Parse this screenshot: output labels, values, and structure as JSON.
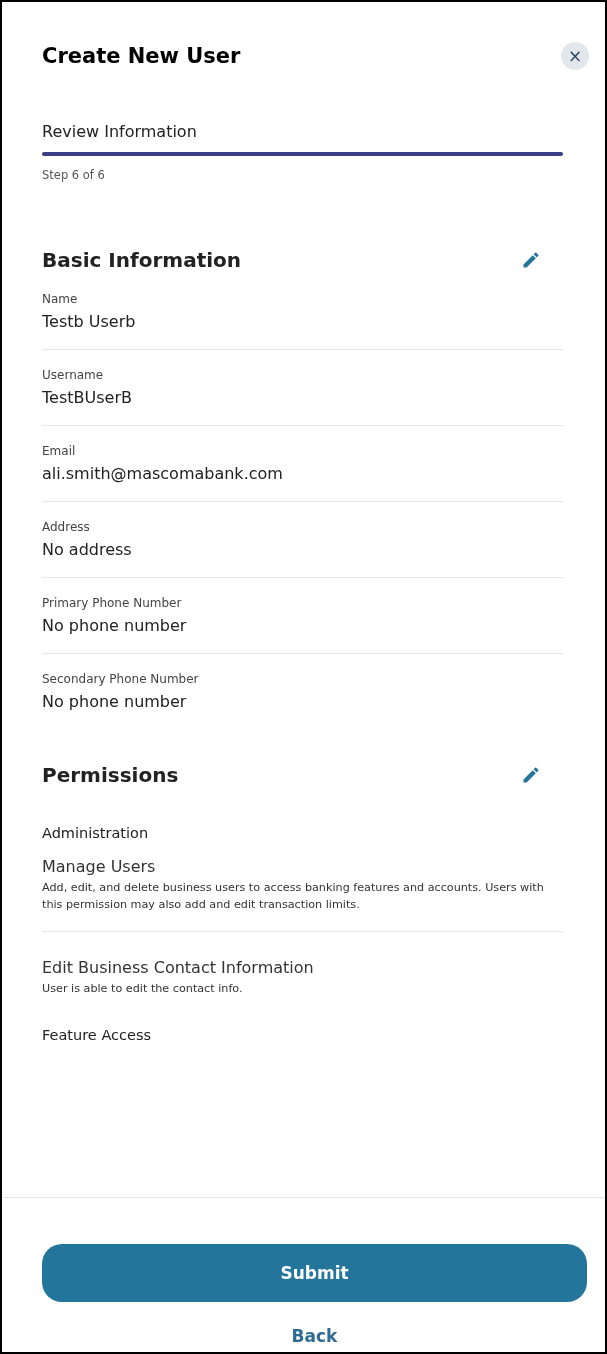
{
  "dialog": {
    "title": "Create New User",
    "close_label": "×"
  },
  "progress": {
    "step_title": "Review Information",
    "level": 1,
    "step_text": "Step 6 of 6"
  },
  "sections": [
    {
      "heading": "Basic Information",
      "kind": "fields",
      "fields": [
        {
          "label": "Name",
          "value": "Testb Userb"
        },
        {
          "label": "Username",
          "value": "TestBUserB"
        },
        {
          "label": "Email",
          "value": "ali.smith@mascomabank.com"
        },
        {
          "label": "Address",
          "value": "No address"
        },
        {
          "label": "Primary Phone Number",
          "value": "No phone number"
        },
        {
          "label": "Secondary Phone Number",
          "value": "No phone number"
        }
      ]
    },
    {
      "heading": "Permissions",
      "kind": "permissions",
      "groups": [
        {
          "name": "Administration",
          "items": [
            {
              "title": "Manage Users",
              "description": "Add, edit, and delete business users to access banking features and accounts. Users with this permission may also add and edit transaction limits."
            },
            {
              "title": "Edit Business Contact Information",
              "description": "User is able to edit the contact info."
            }
          ]
        },
        {
          "name": "Feature Access"
        }
      ]
    }
  ],
  "footer": {
    "submit": "Submit",
    "back": "Back"
  }
}
